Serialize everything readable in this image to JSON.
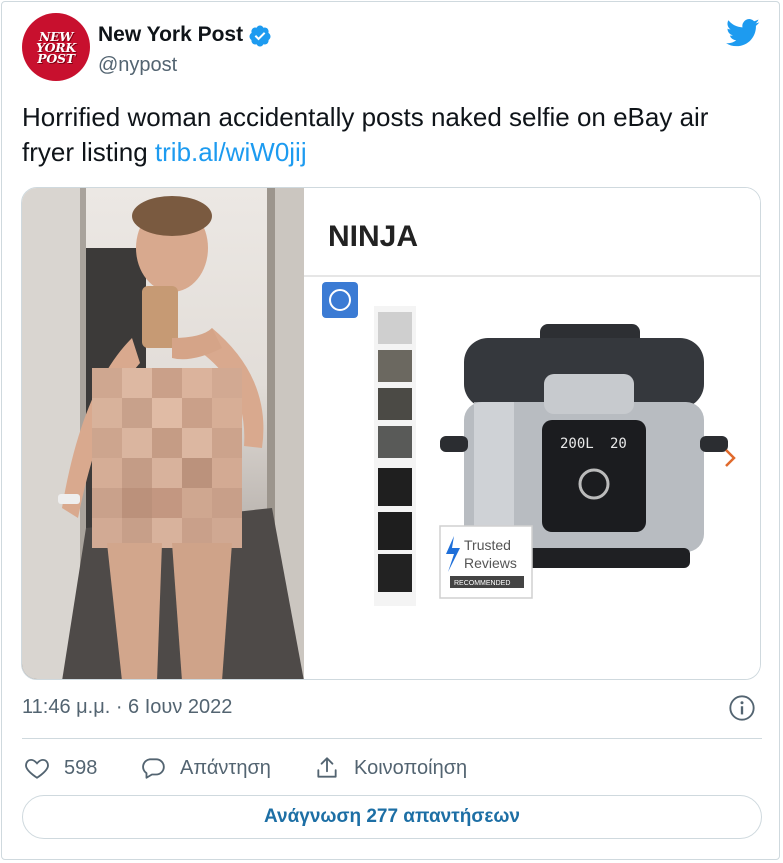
{
  "author": {
    "avatar_text": [
      "NEW",
      "YORK",
      "POST"
    ],
    "name": "New York Post",
    "handle": "@nypost",
    "verified": true
  },
  "tweet": {
    "text": "Horrified woman accidentally posts naked selfie on eBay air fryer listing ",
    "link_text": "trib.al/wiW0jij"
  },
  "media": {
    "product_brand": "NINJA",
    "cooker_display_left": "200L",
    "cooker_display_right": "20",
    "badge_line1": "Trusted",
    "badge_line2": "Reviews",
    "badge_line3": "RECOMMENDED"
  },
  "meta": {
    "timestamp": "11:46 μ.μ. · 6 Ιουν 2022"
  },
  "actions": {
    "like_count": "598",
    "reply_label": "Απάντηση",
    "share_label": "Κοινοποίηση"
  },
  "read_replies_label": "Ανάγνωση 277 απαντήσεων",
  "colors": {
    "twitter_blue": "#1d9bf0",
    "avatar_red": "#c8102e",
    "text_secondary": "#536471",
    "border": "#cfd9de"
  },
  "icons": [
    "verified-badge-icon",
    "twitter-bird-icon",
    "info-icon",
    "heart-icon",
    "reply-icon",
    "share-icon"
  ]
}
